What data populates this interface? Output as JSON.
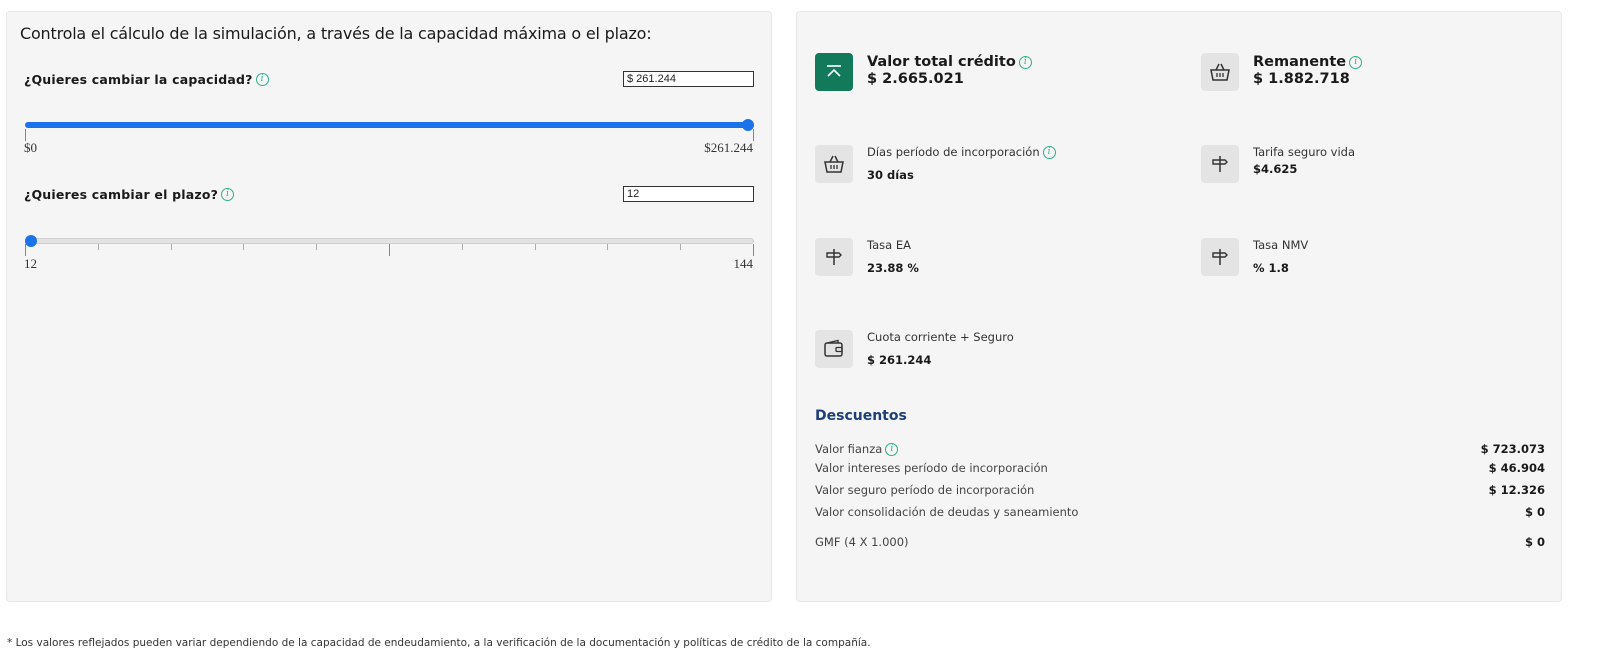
{
  "simulator": {
    "heading": "Controla el cálculo de la simulación, a través de la capacidad máxima o el plazo:",
    "capacity": {
      "label": "¿Quieres cambiar la capacidad?",
      "value": "$ 261.244",
      "min_label": "$0",
      "max_label": "$261.244",
      "level": 1.0
    },
    "term": {
      "label": "¿Quieres cambiar el plazo?",
      "value": "12",
      "min_label": "12",
      "max_label": "144",
      "level": 0.0
    }
  },
  "summary": {
    "total_credit": {
      "title": "Valor total crédito",
      "value": "$ 2.665.021",
      "icon": "arrow-up-icon"
    },
    "remaining": {
      "title": "Remanente",
      "value": "$ 1.882.718",
      "icon": "basket-icon"
    },
    "incorporation_days": {
      "title": "Días período de incorporación",
      "value": "30 días",
      "icon": "basket-icon"
    },
    "life_insurance": {
      "title": "Tarifa seguro vida",
      "value": "$4.625",
      "icon": "signpost-icon"
    },
    "ea_rate": {
      "title": "Tasa EA",
      "value": "23.88 %",
      "icon": "signpost-icon"
    },
    "nmv_rate": {
      "title": "Tasa NMV",
      "value": "% 1.8",
      "icon": "signpost-icon"
    },
    "installment": {
      "title": "Cuota corriente + Seguro",
      "value": "$ 261.244",
      "icon": "wallet-icon"
    }
  },
  "discounts": {
    "heading": "Descuentos",
    "rows": [
      {
        "label": "Valor fianza",
        "amount": "$ 723.073"
      },
      {
        "label": "Valor intereses período de incorporación",
        "amount": "$ 46.904"
      },
      {
        "label": "Valor seguro período de incorporación",
        "amount": "$ 12.326"
      },
      {
        "label": "Valor consolidación de deudas y saneamiento",
        "amount": "$ 0"
      },
      {
        "label": "GMF (4 X 1.000)",
        "amount": "$ 0"
      }
    ]
  },
  "footnote": "* Los valores reflejados pueden variar dependiendo de la capacidad de endeudamiento, a la verificación de la documentación y políticas de crédito de la compañía.",
  "colors": {
    "accent": "#1a73e8",
    "brand_green": "#127a5a",
    "heading_blue": "#1d3f78",
    "info_green": "#2bb08a"
  }
}
